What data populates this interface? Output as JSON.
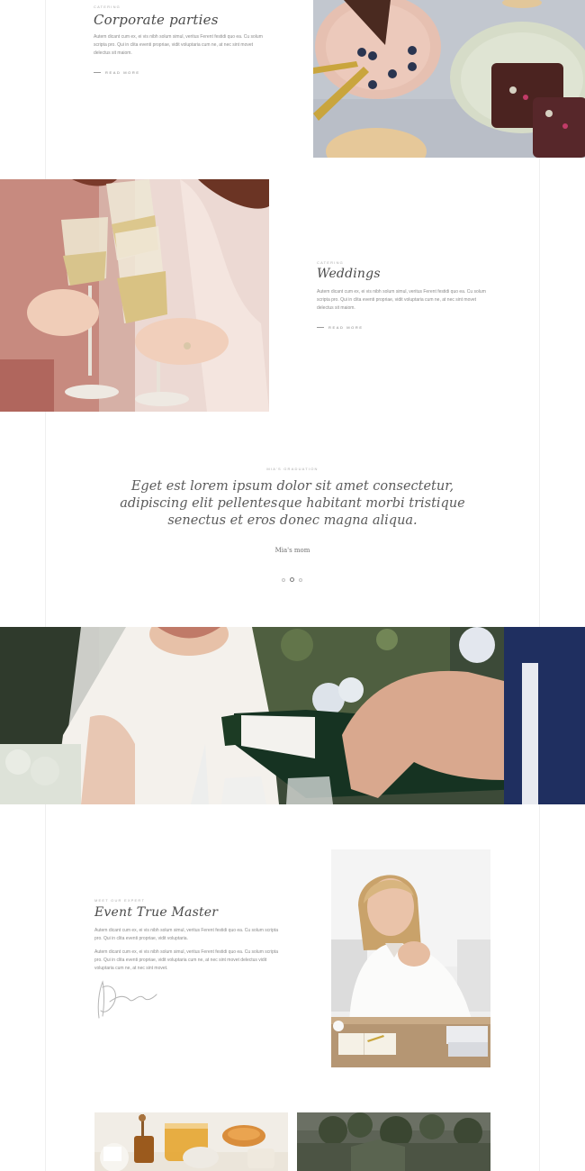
{
  "corporate": {
    "eyebrow": "CATERING",
    "title": "Corporate parties",
    "body": "Autem dicant cum ex, ei vis nibh solum simul, veritus Ferent festidi quo ea. Cu solum scripta pro. Qui in clita eventi propriae, vidit voluptaria cum ne, at nec sint movet delectus sit maiom.",
    "read_more": "READ MORE"
  },
  "weddings": {
    "eyebrow": "CATERING",
    "title": "Weddings",
    "body": "Autem dicant cum ex, ei vis nibh solum simul, veritus Ferent festidi quo ea. Cu solum scripta pro. Qui in clita eventi propriae, vidit voluptaria cum ne, at nec sint movet delectus sit maiom.",
    "read_more": "READ MORE"
  },
  "testimonial": {
    "eyebrow": "MIA'S GRADUATION",
    "quote": "Eget est lorem ipsum dolor sit amet consectetur, adipiscing elit pellentesque habitant morbi tristique senectus et eros donec magna aliqua.",
    "author": "Mia's mom",
    "dots_total": 3,
    "active_dot": 2
  },
  "expert": {
    "eyebrow": "MEET OUR EXPERT",
    "title": "Event True Master",
    "body1": "Autem dicant cum ex, ei vis nibh solum simul, veritus Ferent festidi quo ea. Cu solum scripta pro. Qui in clita eventi propriae, vidit voluptaria.",
    "body2": "Autem dicant cum ex, ei vis nibh solum simul, veritus Ferent festidi quo ea. Cu solum scripta pro. Qui in clita eventi propriae, vidit voluptaria cum ne, at nec sint movet delectus vidit voluptaria cum ne, at nec sint movet."
  },
  "colors": {
    "heading": "#4a4a4a",
    "body": "#8a8a8a",
    "background": "#ffffff"
  }
}
